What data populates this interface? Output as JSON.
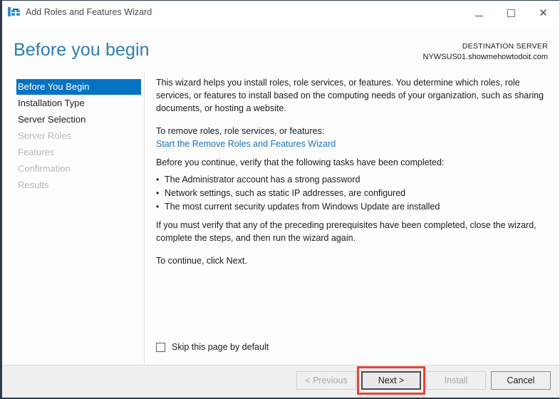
{
  "window": {
    "title": "Add Roles and Features Wizard",
    "icon": "server-roles-icon",
    "controls": {
      "minimize": "minimize-icon",
      "maximize": "maximize-icon",
      "close": "close-icon"
    }
  },
  "header": {
    "page_title": "Before you begin",
    "destination_label": "DESTINATION SERVER",
    "destination_server": "NYWSUS01.showmehowtodoit.com"
  },
  "sidebar": {
    "items": [
      {
        "label": "Before You Begin",
        "state": "selected"
      },
      {
        "label": "Installation Type",
        "state": "enabled"
      },
      {
        "label": "Server Selection",
        "state": "enabled"
      },
      {
        "label": "Server Roles",
        "state": "disabled"
      },
      {
        "label": "Features",
        "state": "disabled"
      },
      {
        "label": "Confirmation",
        "state": "disabled"
      },
      {
        "label": "Results",
        "state": "disabled"
      }
    ]
  },
  "content": {
    "intro_paragraph": "This wizard helps you install roles, role services, or features. You determine which roles, role services, or features to install based on the computing needs of your organization, such as sharing documents, or hosting a website.",
    "remove_lead": "To remove roles, role services, or features:",
    "remove_link": "Start the Remove Roles and Features Wizard",
    "verify_lead": "Before you continue, verify that the following tasks have been completed:",
    "bullets": [
      "The Administrator account has a strong password",
      "Network settings, such as static IP addresses, are configured",
      "The most current security updates from Windows Update are installed"
    ],
    "prerequisite_note": "If you must verify that any of the preceding prerequisites have been completed, close the wizard, complete the steps, and then run the wizard again.",
    "continue_note": "To continue, click Next.",
    "skip_checkbox_label": "Skip this page by default",
    "skip_checkbox_checked": false
  },
  "footer": {
    "buttons": [
      {
        "label": "< Previous",
        "state": "disabled"
      },
      {
        "label": "Next >",
        "state": "focused"
      },
      {
        "label": "Install",
        "state": "disabled"
      },
      {
        "label": "Cancel",
        "state": "enabled"
      }
    ]
  },
  "annotation": {
    "highlight_color": "#e8423a",
    "highlight_target": "Next >"
  }
}
